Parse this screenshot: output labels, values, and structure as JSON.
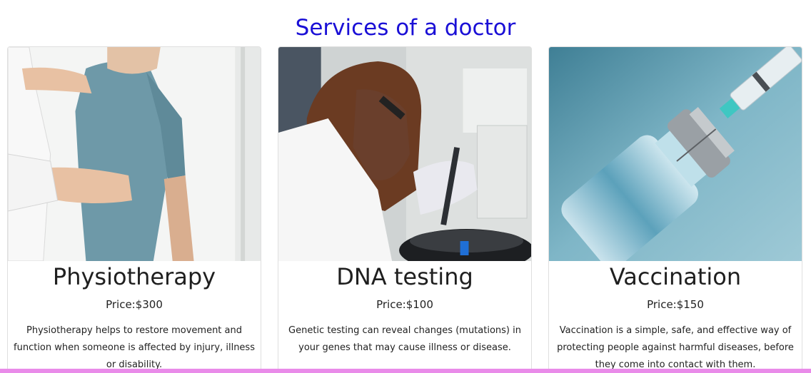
{
  "page": {
    "title": "Services of a doctor",
    "title_color": "#1a0fd6",
    "bottom_bar_color": "#e98be9"
  },
  "services": [
    {
      "image": "physiotherapy-photo",
      "title": "Physiotherapy",
      "price": "Price:$300",
      "description": "Physiotherapy helps to restore movement and function when someone is affected by injury, illness or disability."
    },
    {
      "image": "dna-testing-photo",
      "title": "DNA testing",
      "price": "Price:$100",
      "description": "Genetic testing can reveal changes (mutations) in your genes that may cause illness or disease."
    },
    {
      "image": "vaccination-photo",
      "title": "Vaccination",
      "price": "Price:$150",
      "description": "Vaccination is a simple, safe, and effective way of protecting people against harmful diseases, before they come into contact with them."
    }
  ]
}
